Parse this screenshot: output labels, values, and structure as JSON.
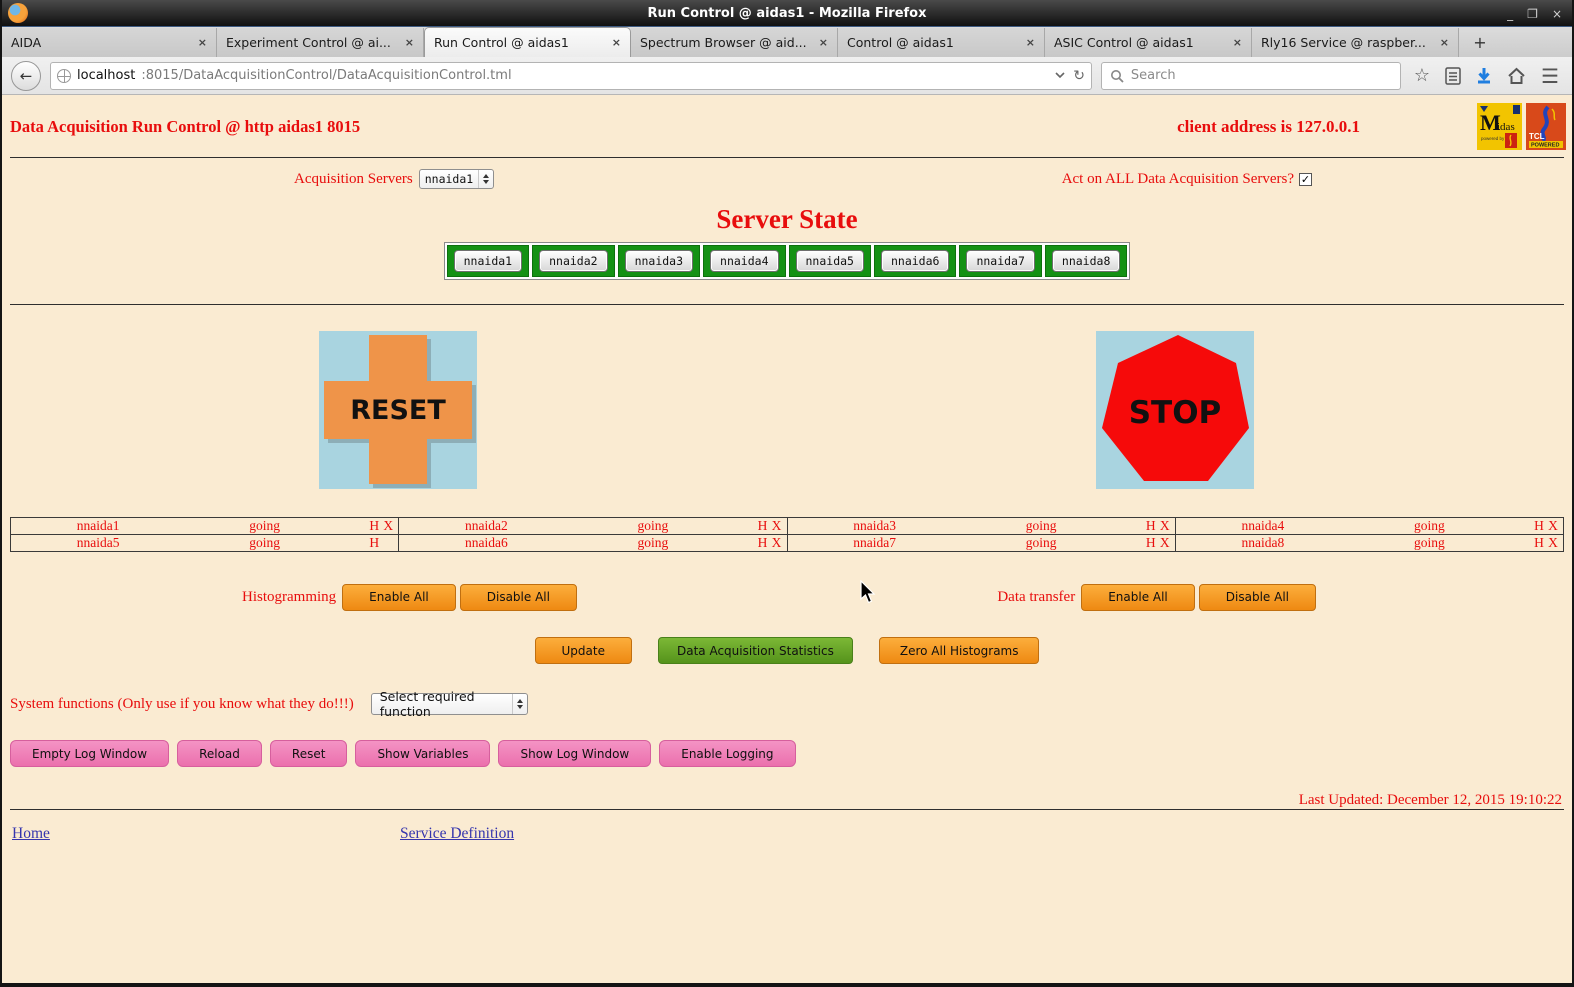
{
  "window": {
    "title": "Run Control @ aidas1 - Mozilla Firefox",
    "controls": {
      "minimize": "_",
      "maximize": "❐",
      "close": "×"
    }
  },
  "tabs": [
    {
      "label": "AIDA",
      "active": false
    },
    {
      "label": "Experiment Control @ ai...",
      "active": false
    },
    {
      "label": "Run Control @ aidas1",
      "active": true
    },
    {
      "label": "Spectrum Browser @ aid...",
      "active": false
    },
    {
      "label": "Control @ aidas1",
      "active": false
    },
    {
      "label": "ASIC Control @ aidas1",
      "active": false
    },
    {
      "label": "Rly16 Service @ raspber...",
      "active": false
    }
  ],
  "ui": {
    "tab_close": "×",
    "new_tab": "+",
    "back_arrow": "←",
    "reload": "↻"
  },
  "navbar": {
    "url_host": "localhost",
    "url_path": ":8015/DataAcquisitionControl/DataAcquisitionControl.tml",
    "search_placeholder": "Search"
  },
  "header": {
    "title": "Data Acquisition Run Control @ http aidas1 8015",
    "client_address": "client address is 127.0.0.1",
    "logo_midas": "Midas",
    "logo_tcl": "TCL POWERED"
  },
  "acquisition": {
    "label": "Acquisition Servers",
    "selected": "nnaida1",
    "act_on_all_label": "Act on ALL Data Acquisition Servers?",
    "act_on_all_checked": true,
    "check_glyph": "✓"
  },
  "server_state": {
    "heading": "Server State",
    "servers": [
      "nnaida1",
      "nnaida2",
      "nnaida3",
      "nnaida4",
      "nnaida5",
      "nnaida6",
      "nnaida7",
      "nnaida8"
    ]
  },
  "big_buttons": {
    "reset": "RESET",
    "stop": "STOP"
  },
  "status_table": {
    "rows": [
      [
        {
          "name": "nnaida1",
          "state": "going",
          "h": "H",
          "x": "X"
        },
        {
          "name": "nnaida2",
          "state": "going",
          "h": "H",
          "x": "X"
        },
        {
          "name": "nnaida3",
          "state": "going",
          "h": "H",
          "x": "X"
        },
        {
          "name": "nnaida4",
          "state": "going",
          "h": "H",
          "x": "X"
        }
      ],
      [
        {
          "name": "nnaida5",
          "state": "going",
          "h": "H",
          "x": ""
        },
        {
          "name": "nnaida6",
          "state": "going",
          "h": "H",
          "x": "X"
        },
        {
          "name": "nnaida7",
          "state": "going",
          "h": "H",
          "x": "X"
        },
        {
          "name": "nnaida8",
          "state": "going",
          "h": "H",
          "x": "X"
        }
      ]
    ]
  },
  "histogramming": {
    "label": "Histogramming",
    "enable": "Enable All",
    "disable": "Disable All"
  },
  "data_transfer": {
    "label": "Data transfer",
    "enable": "Enable All",
    "disable": "Disable All"
  },
  "actions": {
    "update": "Update",
    "statistics": "Data Acquisition Statistics",
    "zero": "Zero All Histograms"
  },
  "system_functions": {
    "label": "System functions (Only use if you know what they do!!!)",
    "selected": "Select required function"
  },
  "log_buttons": [
    "Empty Log Window",
    "Reload",
    "Reset",
    "Show Variables",
    "Show Log Window",
    "Enable Logging"
  ],
  "footer": {
    "last_updated": "Last Updated: December 12, 2015 19:10:22",
    "home": "Home",
    "service": "Service Definition"
  },
  "colors": {
    "page_bg": "#faebd2",
    "accent_red": "#e80d0d",
    "server_green": "#149114",
    "button_orange": "#ee8912",
    "button_green": "#55931b",
    "button_pink": "#eb70ad",
    "image_bg_blue": "#a9d4e0",
    "stop_red": "#f60a0a",
    "reset_orange": "#ef9449",
    "link_blue": "#3535ad"
  }
}
